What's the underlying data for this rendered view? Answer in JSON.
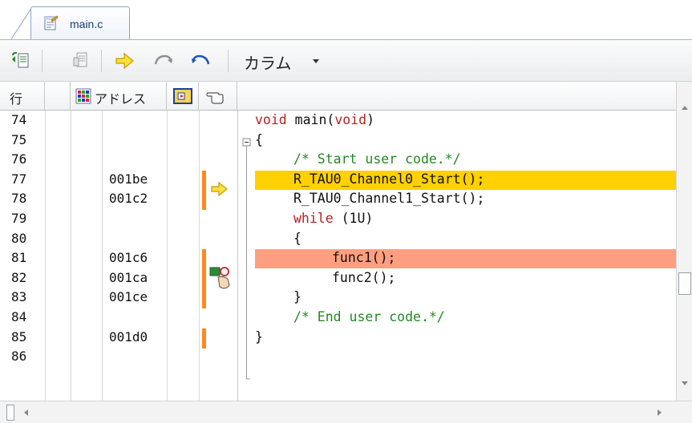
{
  "tab": {
    "label": "main.c",
    "icon": "c-source-file-icon"
  },
  "toolbar": {
    "buttons": [
      {
        "icon": "go-to-source-icon"
      },
      {
        "icon": "disassembly-icon"
      },
      {
        "icon": "current-pc-arrow-icon"
      },
      {
        "icon": "step-over-icon"
      },
      {
        "icon": "return-icon"
      }
    ],
    "column_label": "カラム",
    "column_caret": "dropdown-caret-icon"
  },
  "header": {
    "line_label": "行",
    "address_label": "アドレス",
    "address_icon": "address-grid-icon",
    "event_icon": "event-icon",
    "cursor_icon": "pointing-hand-icon"
  },
  "colors": {
    "pc_highlight": "#ffd100",
    "breakpoint_highlight": "#ff9f80",
    "coverage_bar": "#ff8a1e",
    "keyword": "#b32222",
    "comment": "#218a21"
  },
  "rows": [
    {
      "line": "74",
      "address": "",
      "code": [
        {
          "t": "void",
          "c": "kw"
        },
        {
          "t": " main(",
          "c": "tx"
        },
        {
          "t": "void",
          "c": "kw"
        },
        {
          "t": ")",
          "c": "tx"
        }
      ],
      "indent": 0
    },
    {
      "line": "75",
      "address": "",
      "code": [
        {
          "t": "{",
          "c": "tx"
        }
      ],
      "indent": 0
    },
    {
      "line": "76",
      "address": "",
      "code": [
        {
          "t": "/* Start user code.*/",
          "c": "cm"
        }
      ],
      "indent": 1
    },
    {
      "line": "77",
      "address": "001be",
      "code": [
        {
          "t": "R_TAU0_Channel0_Start();",
          "c": "tx"
        }
      ],
      "indent": 1,
      "highlight": "pc",
      "coverage": true
    },
    {
      "line": "78",
      "address": "001c2",
      "code": [
        {
          "t": "R_TAU0_Channel1_Start();",
          "c": "tx"
        }
      ],
      "indent": 1,
      "coverage": true
    },
    {
      "line": "79",
      "address": "",
      "code": [
        {
          "t": "while",
          "c": "kw"
        },
        {
          "t": " (1U)",
          "c": "tx"
        }
      ],
      "indent": 1
    },
    {
      "line": "80",
      "address": "",
      "code": [
        {
          "t": "{",
          "c": "tx"
        }
      ],
      "indent": 1
    },
    {
      "line": "81",
      "address": "001c6",
      "code": [
        {
          "t": "func1();",
          "c": "tx"
        }
      ],
      "indent": 2,
      "highlight": "breakpoint",
      "coverage": true
    },
    {
      "line": "82",
      "address": "001ca",
      "code": [
        {
          "t": "func2();",
          "c": "tx"
        }
      ],
      "indent": 2,
      "coverage": true
    },
    {
      "line": "83",
      "address": "001ce",
      "code": [
        {
          "t": "}",
          "c": "tx"
        }
      ],
      "indent": 1,
      "coverage": true
    },
    {
      "line": "84",
      "address": "",
      "code": [
        {
          "t": "/* End user code.*/",
          "c": "cm"
        }
      ],
      "indent": 1
    },
    {
      "line": "85",
      "address": "001d0",
      "code": [
        {
          "t": "}",
          "c": "tx"
        }
      ],
      "indent": 0,
      "coverage": true
    },
    {
      "line": "86",
      "address": "",
      "code": [],
      "indent": 0
    }
  ]
}
